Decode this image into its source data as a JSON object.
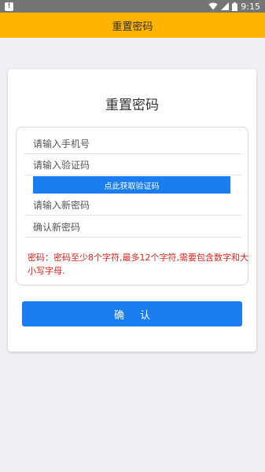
{
  "status_bar": {
    "alert": "!",
    "time": "9:15",
    "icons": [
      "wifi-icon",
      "signal-icon",
      "battery-icon"
    ]
  },
  "app_bar": {
    "title": "重置密码",
    "color": "#ffb300"
  },
  "card": {
    "title": "重置密码",
    "fields": {
      "phone_placeholder": "请输入手机号",
      "code_placeholder": "请输入验证码",
      "new_password_placeholder": "请输入新密码",
      "confirm_password_placeholder": "确认新密码"
    },
    "get_code_label": "点此获取验证码",
    "hint": "密码：密码至少8个字符,最多12个字符,需要包含数字和大小写字母.",
    "confirm_label": "确认"
  },
  "colors": {
    "accent": "#1a7ef2",
    "hint": "#e0241c",
    "status_bar": "#757575"
  }
}
